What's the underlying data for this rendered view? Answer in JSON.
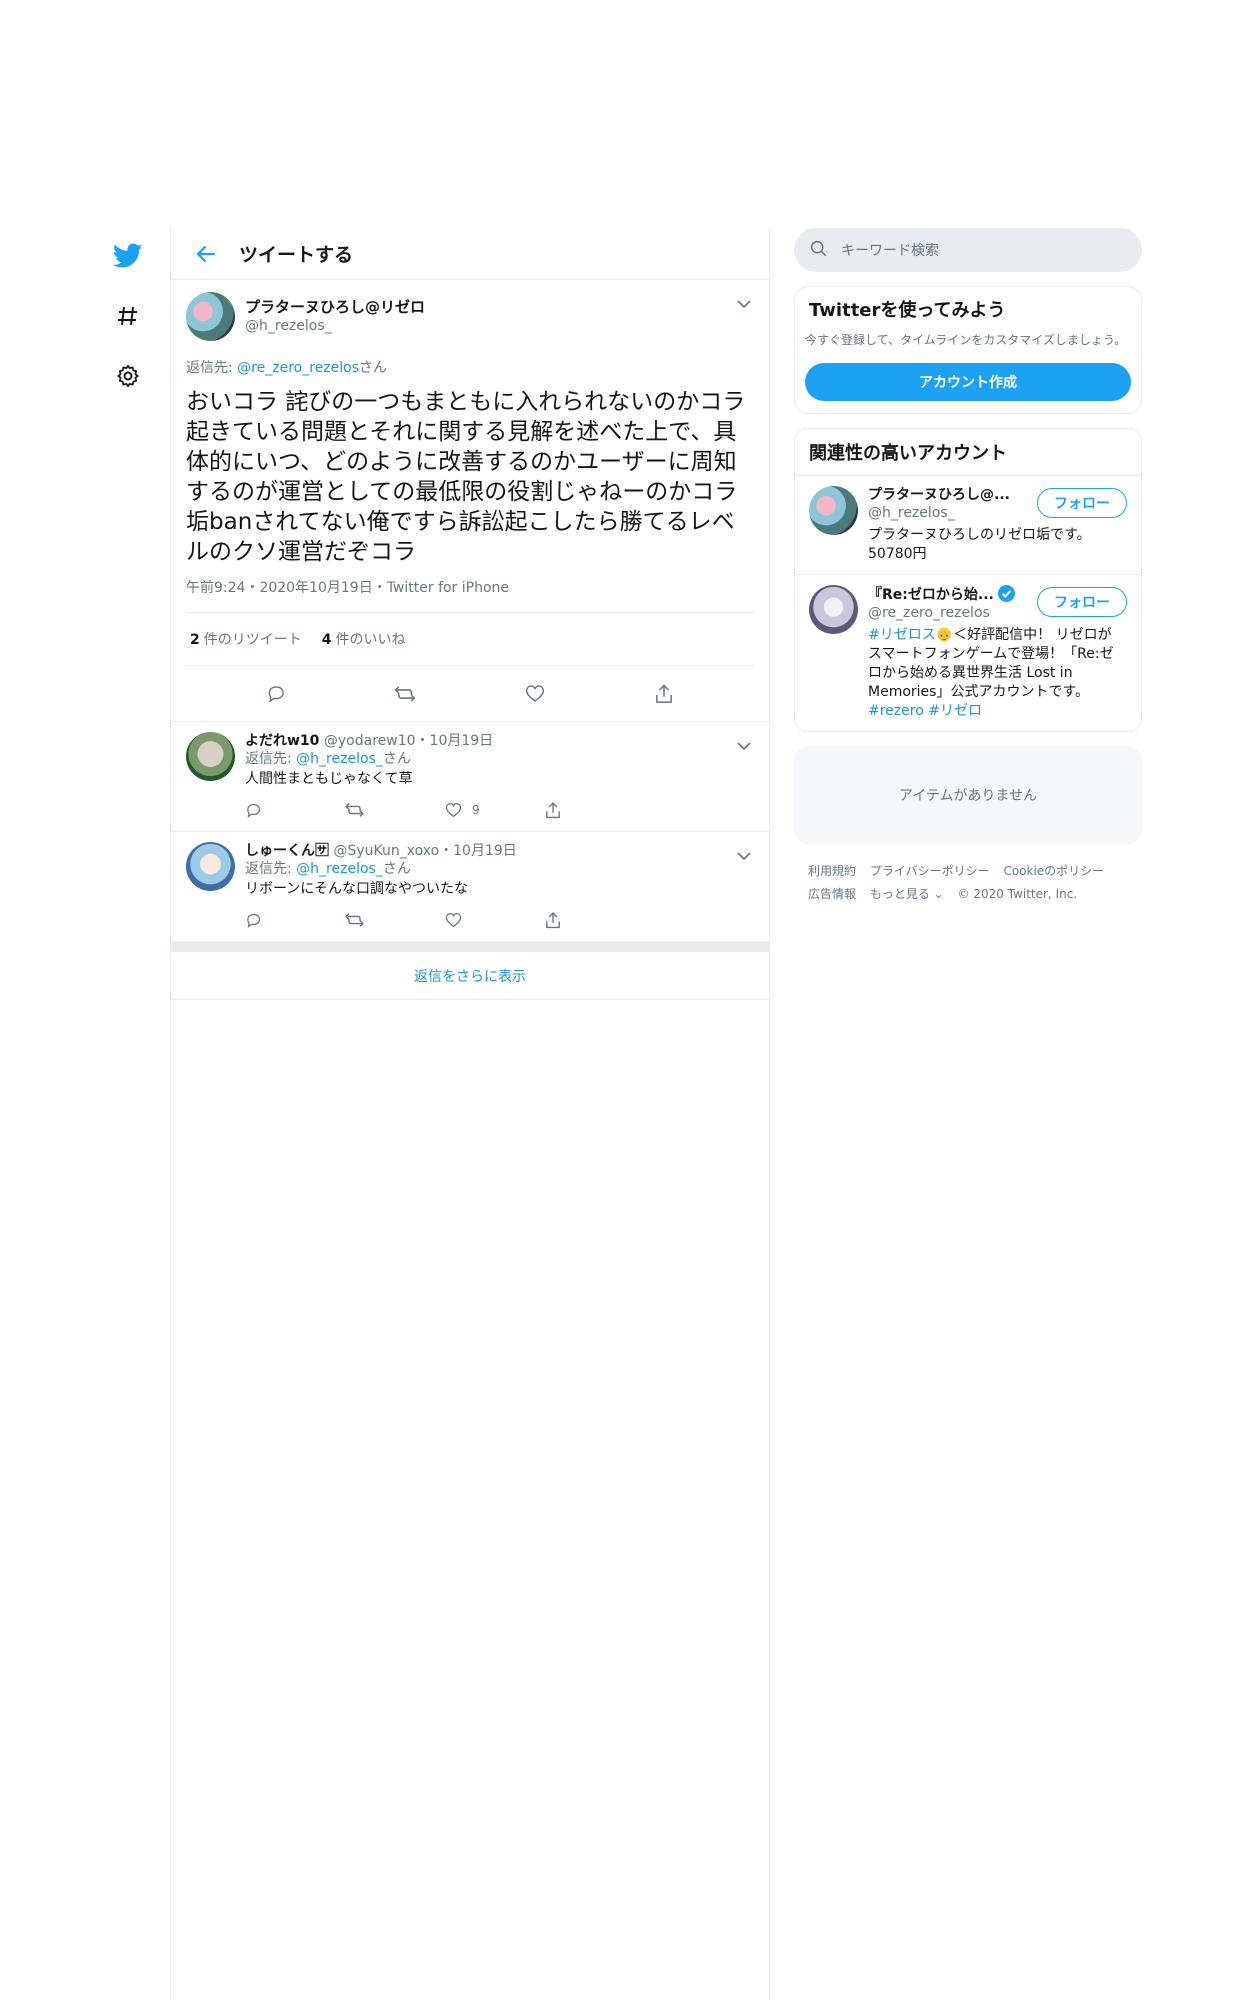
{
  "nav": {
    "items": [
      {
        "icon": "twitter-bird-icon",
        "color": "#1da1f2"
      },
      {
        "icon": "hashtag-icon"
      },
      {
        "icon": "gear-icon"
      }
    ]
  },
  "header": {
    "title": "ツイートする"
  },
  "tweet": {
    "display_name": "プラターヌひろし@リゼロ",
    "handle": "@h_rezelos_",
    "reply_prefix": "返信先: ",
    "reply_to": "@re_zero_rezelos",
    "reply_suffix": "さん",
    "text": "おいコラ 詫びの一つもまともに入れられないのかコラ\n起きている問題とそれに関する見解を述べた上で、具体的にいつ、どのように改善するのかユーザーに周知するのが運営としての最低限の役割じゃねーのかコラ垢banされてない俺ですら訴訟起こしたら勝てるレベルのクソ運営だぞコラ",
    "meta": "午前9:24・2020年10月19日・Twitter for iPhone",
    "retweets_count": "2",
    "retweets_label": "件のリツイート",
    "likes_count": "4",
    "likes_label": "件のいいね"
  },
  "replies": [
    {
      "display_name": "よだれw10",
      "handle": "@yodarew10",
      "date": "・10月19日",
      "reply_prefix": "返信先: ",
      "reply_to": "@h_rezelos_",
      "reply_suffix": "さん",
      "text": "人間性まともじゃなくて草",
      "like_count": "9"
    },
    {
      "display_name": "しゅーくん🈂",
      "handle": "@SyuKun_xoxo",
      "date": "・10月19日",
      "reply_prefix": "返信先: ",
      "reply_to": "@h_rezelos_",
      "reply_suffix": "さん",
      "text": "リボーンにそんな口調なやついたな",
      "like_count": ""
    }
  ],
  "show_more": "返信をさらに表示",
  "sidebar": {
    "search_placeholder": "キーワード検索",
    "signup": {
      "title": "Twitterを使ってみよう",
      "subtitle": "今すぐ登録して、タイムラインをカスタマイズしましょう。",
      "button": "アカウント作成"
    },
    "related": {
      "title": "関連性の高いアカウント",
      "accounts": [
        {
          "name": "プラターヌひろし@...",
          "handle": "@h_rezelos_",
          "bio": "プラターヌひろしのリゼロ垢です。50780円",
          "follow": "フォロー"
        },
        {
          "name": "『Re:ゼロから始...",
          "handle": "@re_zero_rezelos",
          "bio_hashtag1": "#リゼロス",
          "bio_rest": "👴＜好評配信中！ リゼロがスマートフォンゲームで登場！「Re:ゼロから始める異世界生活 Lost in Memories」公式アカウントです。",
          "bio_hashtag2": "#rezero #リゼロ",
          "follow": "フォロー"
        }
      ]
    },
    "empty": "アイテムがありません",
    "footer": {
      "line1": [
        "利用規約",
        "プライバシーポリシー",
        "Cookieのポリシー"
      ],
      "line2": [
        "広告情報",
        "もっと見る ⌄",
        "© 2020 Twitter, Inc."
      ]
    }
  },
  "colors": {
    "accent": "#1da1f2",
    "link": "#1b95e0",
    "muted": "#657786",
    "border": "#e6ecf0"
  }
}
